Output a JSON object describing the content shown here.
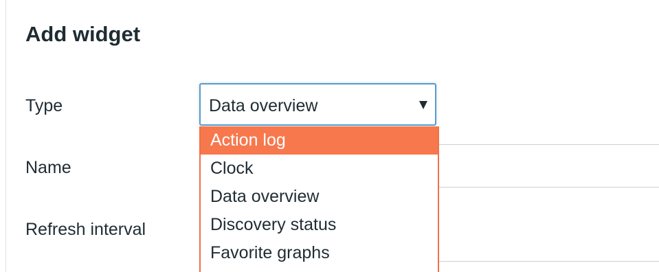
{
  "dialog": {
    "title": "Add widget"
  },
  "form": {
    "type_label": "Type",
    "name_label": "Name",
    "refresh_label": "Refresh interval",
    "type_select": {
      "selected": "Data overview",
      "options": [
        "Action log",
        "Clock",
        "Data overview",
        "Discovery status",
        "Favorite graphs"
      ],
      "highlighted": "Action log"
    }
  },
  "colors": {
    "highlight": "#f7784d",
    "focus_border": "#5b9bc5",
    "text": "#1f2c33"
  },
  "icons": {
    "select_arrow": "triangle-down-icon"
  }
}
